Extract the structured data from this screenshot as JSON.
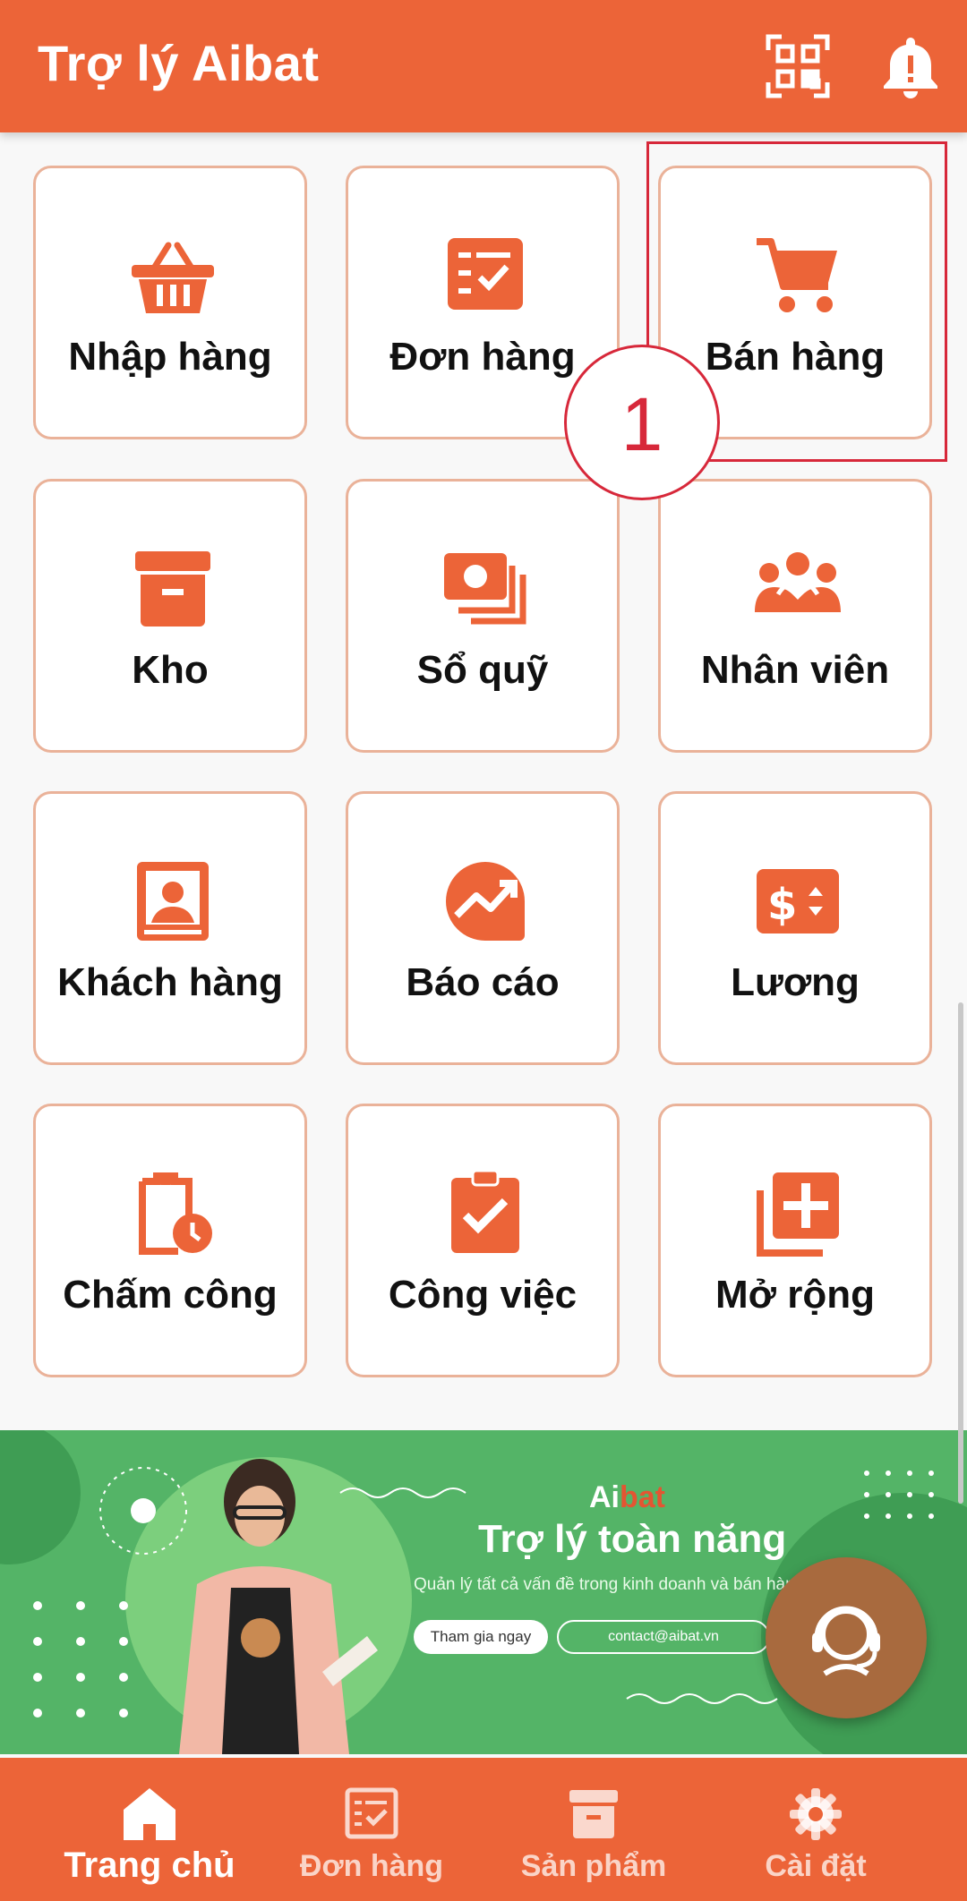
{
  "header": {
    "title": "Trợ lý Aibat",
    "qr_icon": "qr-scan-icon",
    "bell_icon": "bell-icon"
  },
  "grid": [
    {
      "label": "Nhập hàng",
      "icon": "basket-icon"
    },
    {
      "label": "Đơn hàng",
      "icon": "order-list-icon"
    },
    {
      "label": "Bán hàng",
      "icon": "cart-icon"
    },
    {
      "label": "Kho",
      "icon": "archive-box-icon"
    },
    {
      "label": "Sổ quỹ",
      "icon": "cash-icon"
    },
    {
      "label": "Nhân viên",
      "icon": "group-icon"
    },
    {
      "label": "Khách hàng",
      "icon": "contact-card-icon"
    },
    {
      "label": "Báo cáo",
      "icon": "trend-chart-icon"
    },
    {
      "label": "Lương",
      "icon": "salary-icon"
    },
    {
      "label": "Chấm công",
      "icon": "clipboard-clock-icon"
    },
    {
      "label": "Công việc",
      "icon": "clipboard-check-icon"
    },
    {
      "label": "Mở rộng",
      "icon": "add-box-icon"
    }
  ],
  "annotation": {
    "step_number": "1",
    "highlight_color": "#d7283a"
  },
  "banner": {
    "brand_a": "Ai",
    "brand_b": "bat",
    "title": "Trợ lý toàn năng",
    "subtitle": "Quản lý tất cả vấn đề trong kinh doanh và bán hàng của bạn.",
    "cta": "Tham gia ngay",
    "contact": "contact@aibat.vn"
  },
  "bottom_nav": [
    {
      "label": "Trang chủ",
      "icon": "home-icon",
      "active": true
    },
    {
      "label": "Đơn hàng",
      "icon": "order-list-icon",
      "active": false
    },
    {
      "label": "Sản phẩm",
      "icon": "archive-box-icon",
      "active": false
    },
    {
      "label": "Cài đặt",
      "icon": "gear-icon",
      "active": false
    }
  ],
  "colors": {
    "primary": "#ec6438",
    "tile_border": "#eab299",
    "banner_green": "#54b467"
  }
}
